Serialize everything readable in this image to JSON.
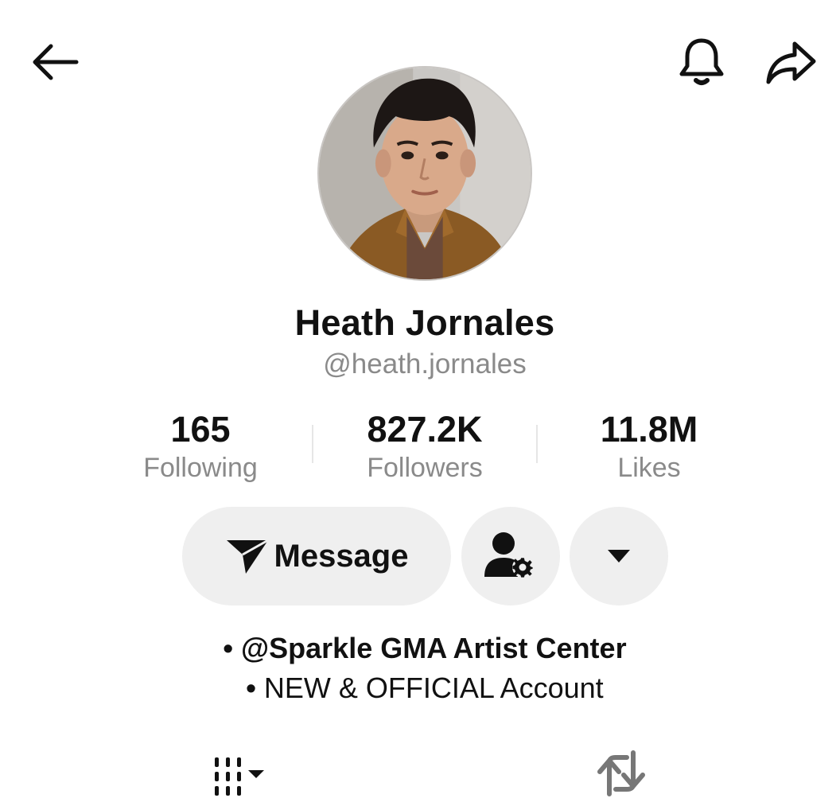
{
  "header": {
    "back_icon": "arrow-left-icon",
    "notification_icon": "bell-icon",
    "share_icon": "share-arrow-icon"
  },
  "profile": {
    "display_name": "Heath Jornales",
    "username": "@heath.jornales"
  },
  "stats": [
    {
      "value": "165",
      "label": "Following"
    },
    {
      "value": "827.2K",
      "label": "Followers"
    },
    {
      "value": "11.8M",
      "label": "Likes"
    }
  ],
  "actions": {
    "message_label": "Message",
    "message_icon": "send-icon",
    "add_friend_icon": "person-gear-icon",
    "more_icon": "caret-down-icon"
  },
  "bio": {
    "bullet": "•",
    "line1": "@Sparkle GMA Artist Center",
    "line2": "NEW & OFFICIAL Account"
  },
  "tabs": {
    "videos_icon": "grid-dropdown-icon",
    "reposts_icon": "repost-icon"
  },
  "colors": {
    "text_primary": "#111111",
    "text_secondary": "#8a8a8a",
    "button_bg": "#efefef"
  }
}
